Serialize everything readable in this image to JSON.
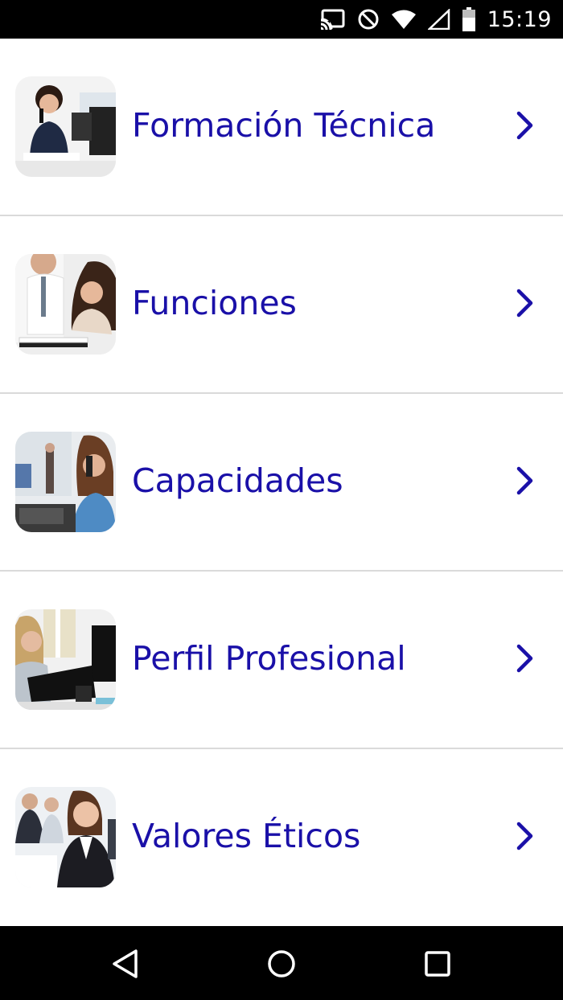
{
  "status_bar": {
    "time": "15:19",
    "icons": [
      "cast-icon",
      "do-not-disturb-icon",
      "wifi-icon",
      "signal-icon",
      "battery-icon"
    ]
  },
  "menu": {
    "items": [
      {
        "label": "Formación Técnica",
        "thumbnail": "woman-on-phone-at-desk-photo"
      },
      {
        "label": "Funciones",
        "thumbnail": "colleagues-reviewing-documents-photo"
      },
      {
        "label": "Capacidades",
        "thumbnail": "woman-on-phone-office-photo"
      },
      {
        "label": "Perfil Profesional",
        "thumbnail": "woman-with-folder-photo"
      },
      {
        "label": "Valores Éticos",
        "thumbnail": "businesswoman-with-team-photo"
      }
    ]
  },
  "colors": {
    "label": "#1a10a8",
    "divider": "#dadada",
    "system_bars": "#000000"
  },
  "navigation_bar": {
    "buttons": [
      "back-icon",
      "home-icon",
      "recents-icon"
    ]
  }
}
